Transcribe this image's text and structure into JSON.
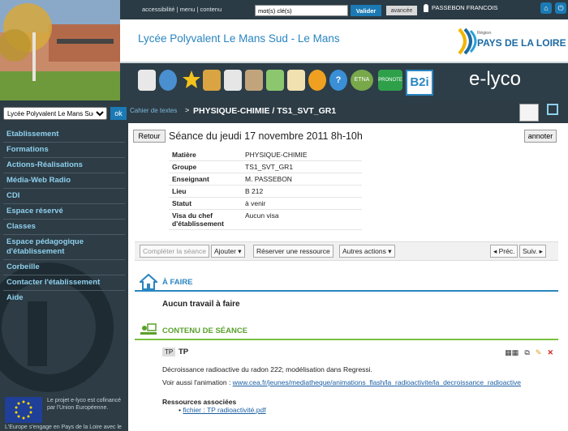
{
  "topbar": {
    "accessibility": "accessibilité",
    "menu": "menu",
    "contenu": "contenu",
    "search_value": "mot(s) clé(s)",
    "valider": "Valider",
    "avancee": "avancée",
    "user_name": "PASSEBON FRANCOIS"
  },
  "header": {
    "title": "Lycée Polyvalent Le Mans Sud - Le Mans",
    "region_small": "Région",
    "region_name": "PAYS DE LA LOIRE",
    "brand": "e-lyco",
    "icon_labels": [
      "ETNA",
      "PRONOTE",
      "B2i"
    ]
  },
  "sidebar": {
    "school_select": "Lycée Polyvalent Le Mans Sud - L",
    "ok": "ok",
    "items": [
      "Etablissement",
      "Formations",
      "Actions-Réalisations",
      "Média-Web Radio",
      "CDI",
      "Espace réservé",
      "Classes",
      "Espace pédagogique d'établissement",
      "Corbeille",
      "Contacter l'établissement",
      "Aide"
    ],
    "eu_text": "Le projet e-lyco est cofinancé par l'Union Européenne.",
    "eu_engage": "L'Europe s'engage en Pays de la Loire avec le"
  },
  "main": {
    "crumb_root": "Cahier de textes",
    "crumb_sep": ">",
    "crumb_current": "PHYSIQUE-CHIMIE / TS1_SVT_GR1",
    "retour": "Retour",
    "annoter": "annoter",
    "seance_title": "Séance du jeudi 17 novembre 2011 8h-10h",
    "info": [
      {
        "k": "Matière",
        "v": "PHYSIQUE-CHIMIE"
      },
      {
        "k": "Groupe",
        "v": "TS1_SVT_GR1"
      },
      {
        "k": "Enseignant",
        "v": "M. PASSEBON"
      },
      {
        "k": "Lieu",
        "v": "B 212"
      },
      {
        "k": "Statut",
        "v": "à venir"
      },
      {
        "k": "Visa du chef d'établissement",
        "v": "Aucun visa"
      }
    ],
    "actions": {
      "completer": "Compléter la séance",
      "ajouter": "Ajouter ▾",
      "reserver": "Réserver une ressource",
      "autres": "Autres actions ▾",
      "prec": "◂ Préc.",
      "suiv": "Suiv. ▸"
    },
    "afaire_label": "À FAIRE",
    "aucun_travail": "Aucun travail à faire",
    "contenu_label": "CONTENU DE SÉANCE",
    "tp_badge": "TP",
    "tp_title": "TP",
    "tp_desc": "Décroissance radioactive du radon 222; modélisation dans Regressi.",
    "voir_prefix": "Voir aussi l'animation : ",
    "voir_link": "www.cea.fr/jeunes/mediatheque/animations_flash/la_radioactivite/la_decroissance_radioactive",
    "ressources_label": "Ressources associées",
    "ressource_item": "fichier : TP radioactivité.pdf"
  }
}
